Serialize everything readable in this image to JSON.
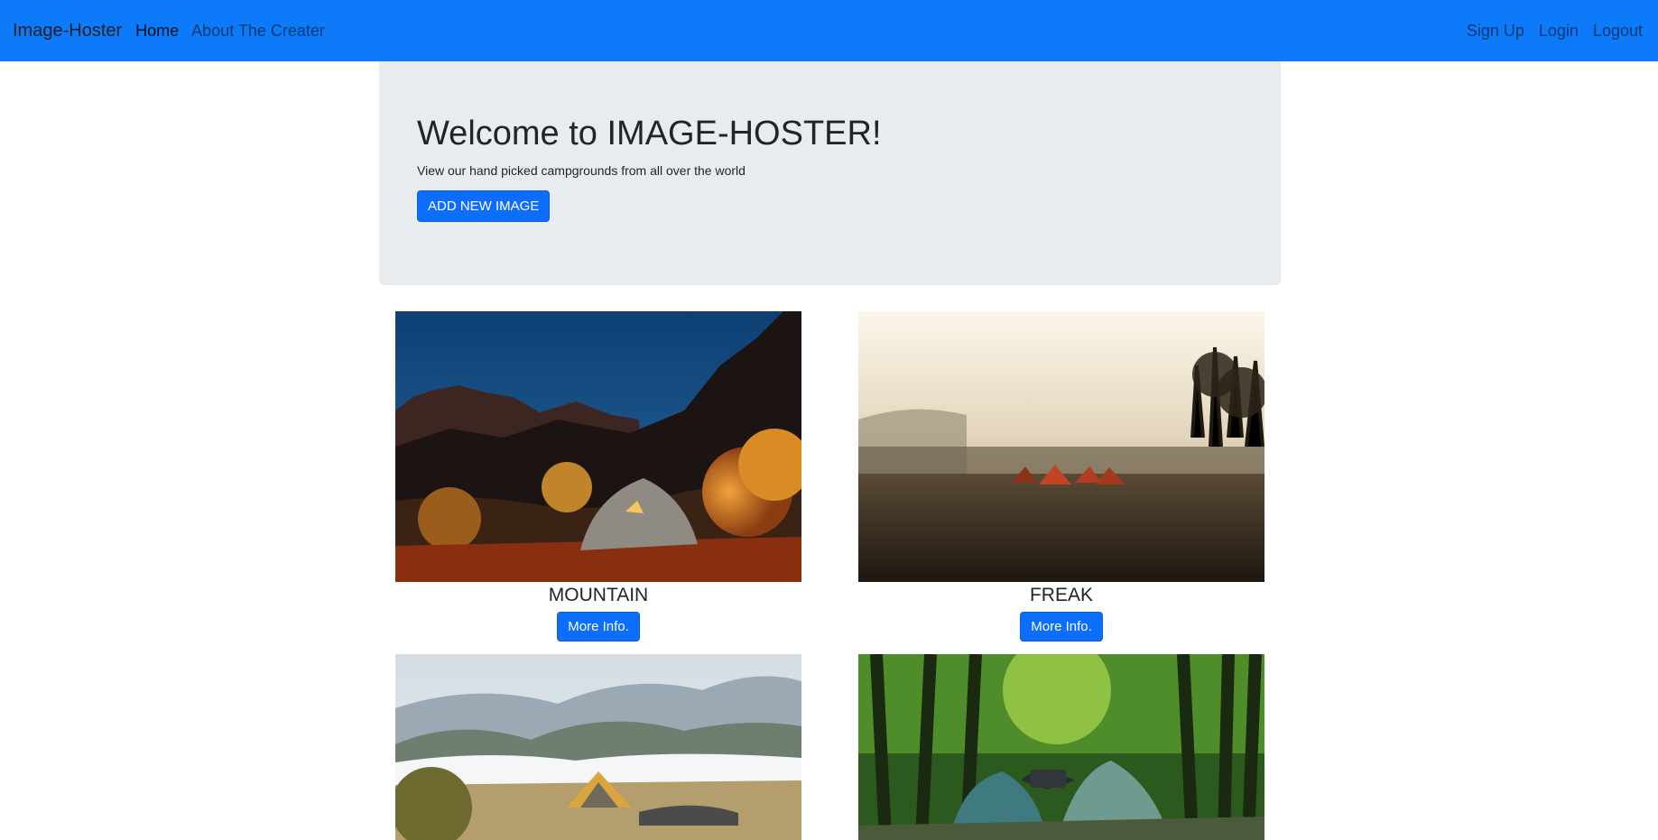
{
  "navbar": {
    "brand": "Image-Hoster",
    "links": [
      "Home",
      "About The Creater"
    ],
    "right_links": [
      "Sign Up",
      "Login",
      "Logout"
    ]
  },
  "hero": {
    "title": "Welcome to IMAGE-HOSTER!",
    "subtitle": "View our hand picked campgrounds from all over the world",
    "add_button": "ADD NEW IMAGE"
  },
  "images": [
    {
      "title": "MOUNTAIN",
      "button": "More Info."
    },
    {
      "title": "FREAK",
      "button": "More Info."
    },
    {
      "title": "",
      "button": ""
    },
    {
      "title": "",
      "button": ""
    }
  ],
  "colors": {
    "navbar": "#0d7bf9",
    "primary": "#0d6efd",
    "jumbotron": "#e9ecef"
  }
}
